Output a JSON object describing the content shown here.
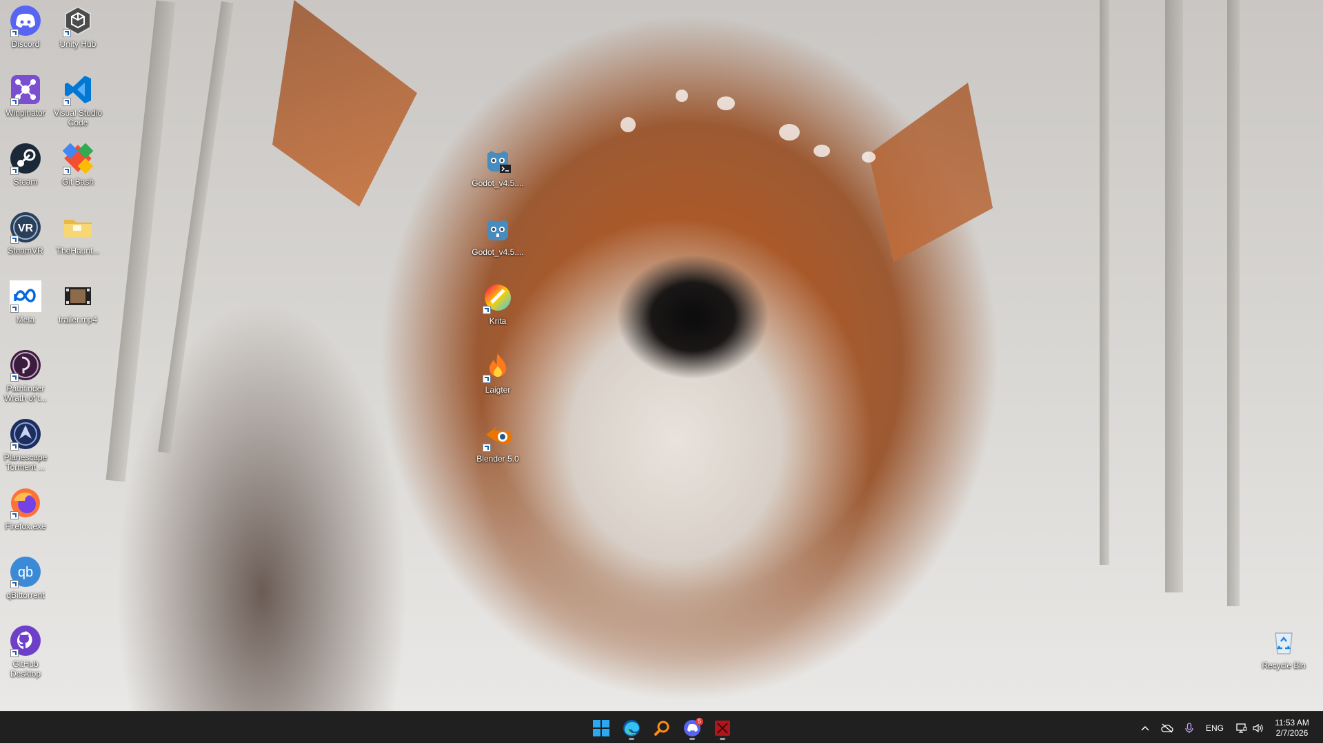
{
  "desktop": {
    "icons": [
      {
        "name": "discord",
        "label": "Discord"
      },
      {
        "name": "unity-hub",
        "label": "Unity Hub"
      },
      {
        "name": "winpinator",
        "label": "Winpinator"
      },
      {
        "name": "visual-studio-code",
        "label": "Visual Studio Code"
      },
      {
        "name": "steam",
        "label": "Steam"
      },
      {
        "name": "git-bash",
        "label": "Git Bash"
      },
      {
        "name": "steamvr",
        "label": "SteamVR"
      },
      {
        "name": "thehaunt-folder",
        "label": "TheHaunt..."
      },
      {
        "name": "meta",
        "label": "Meta"
      },
      {
        "name": "trailer-mp4",
        "label": "trailer.mp4"
      },
      {
        "name": "pathfinder",
        "label": "Pathfinder Wrath of t..."
      },
      {
        "name": "planescape",
        "label": "Planescape Torment ..."
      },
      {
        "name": "firefox",
        "label": "Firefox.exe"
      },
      {
        "name": "qbittorrent",
        "label": "qBittorrent"
      },
      {
        "name": "github-desktop",
        "label": "GitHub Desktop"
      },
      {
        "name": "godot-console",
        "label": "Godot_v4.5...."
      },
      {
        "name": "godot",
        "label": "Godot_v4.5...."
      },
      {
        "name": "krita",
        "label": "Krita"
      },
      {
        "name": "laigter",
        "label": "Laigter"
      },
      {
        "name": "blender",
        "label": "Blender 5.0"
      },
      {
        "name": "recycle-bin",
        "label": "Recycle Bin"
      }
    ]
  },
  "taskbar": {
    "pinned": [
      "windows-start-icon",
      "edge-icon",
      "search-magnifier-icon",
      "discord-icon",
      "red-app-icon"
    ],
    "discord_badge": "5",
    "language": "ENG",
    "time": "11:53 AM",
    "date": "2/7/2026"
  },
  "colors": {
    "taskbar_bg": "#202020",
    "discord": "#5865F2",
    "accent_blue": "#0078D4"
  }
}
